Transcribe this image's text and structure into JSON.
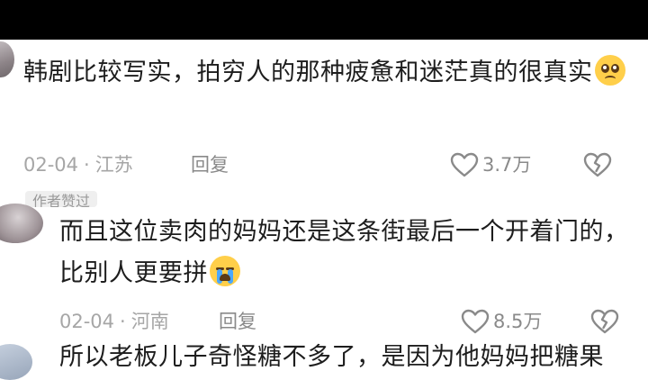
{
  "comments": [
    {
      "text": "韩剧比较写实，拍穷人的那种疲惫和迷茫真的很真实",
      "emoji": "pleading-face",
      "date": "02-04",
      "location": "江苏",
      "reply_label": "回复",
      "likes": "3.7万"
    },
    {
      "badge": "作者赞过",
      "text": "而且这位卖肉的妈妈还是这条街最后一个开着门的，比别人更要拼",
      "emoji": "loudly-crying-face",
      "date": "02-04",
      "location": "河南",
      "reply_label": "回复",
      "likes": "8.5万"
    },
    {
      "text": "所以老板儿子奇怪糖不多了，是因为他妈妈把糖果"
    }
  ],
  "separator": "·",
  "icons": {
    "like": "heart-outline-icon",
    "dislike": "broken-heart-icon"
  },
  "colors": {
    "topbar": "#000000",
    "text": "#1d1d1d",
    "meta": "#a6a6a6",
    "emoji": "#ffcf4a"
  }
}
